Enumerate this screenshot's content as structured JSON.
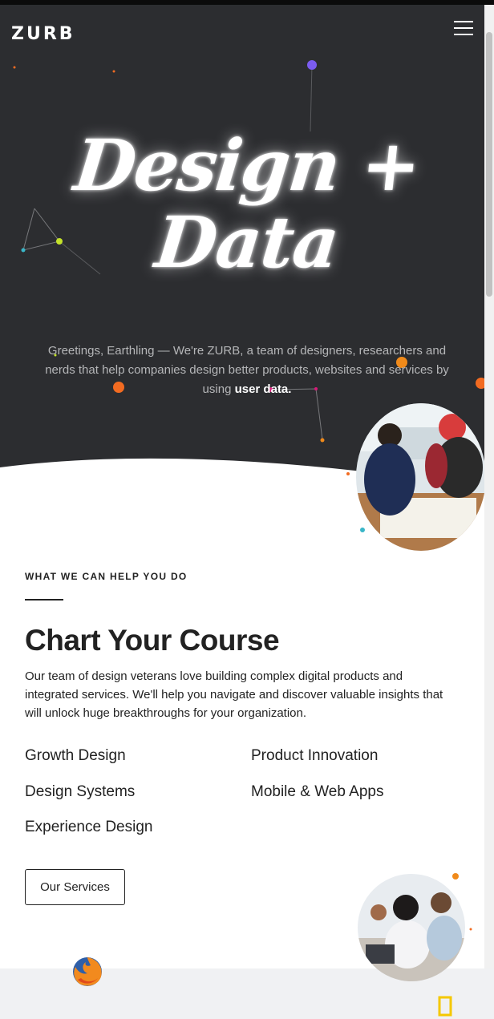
{
  "header": {
    "logo": "ZURB",
    "menu_icon": "hamburger-menu-icon"
  },
  "hero": {
    "headline_line1": "Design +",
    "headline_line2": "Data",
    "intro_text": "Greetings, Earthling — We're ZURB, a team of designers, researchers and nerds that help companies design better products, websites and services by using ",
    "intro_emphasis": "user data."
  },
  "services_section": {
    "eyebrow": "WHAT WE CAN HELP YOU DO",
    "title": "Chart Your Course",
    "description": "Our team of design veterans love building complex digital products and integrated services. We'll help you navigate and discover valuable insights that will unlock huge breakthroughs for your organization.",
    "items": [
      "Growth Design",
      "Product Innovation",
      "Design Systems",
      "Mobile & Web Apps",
      "Experience Design"
    ],
    "cta_label": "Our Services"
  },
  "colors": {
    "hero_bg": "#2c2d30",
    "accent_orange": "#f26b21",
    "accent_purple": "#7b5cf0",
    "accent_lime": "#c4e22a",
    "accent_teal": "#3ab6c8",
    "accent_magenta": "#d91a7a"
  },
  "icons": {
    "firefox_logo": "firefox-logo-icon",
    "national_geographic_logo": "national-geographic-logo-icon"
  }
}
